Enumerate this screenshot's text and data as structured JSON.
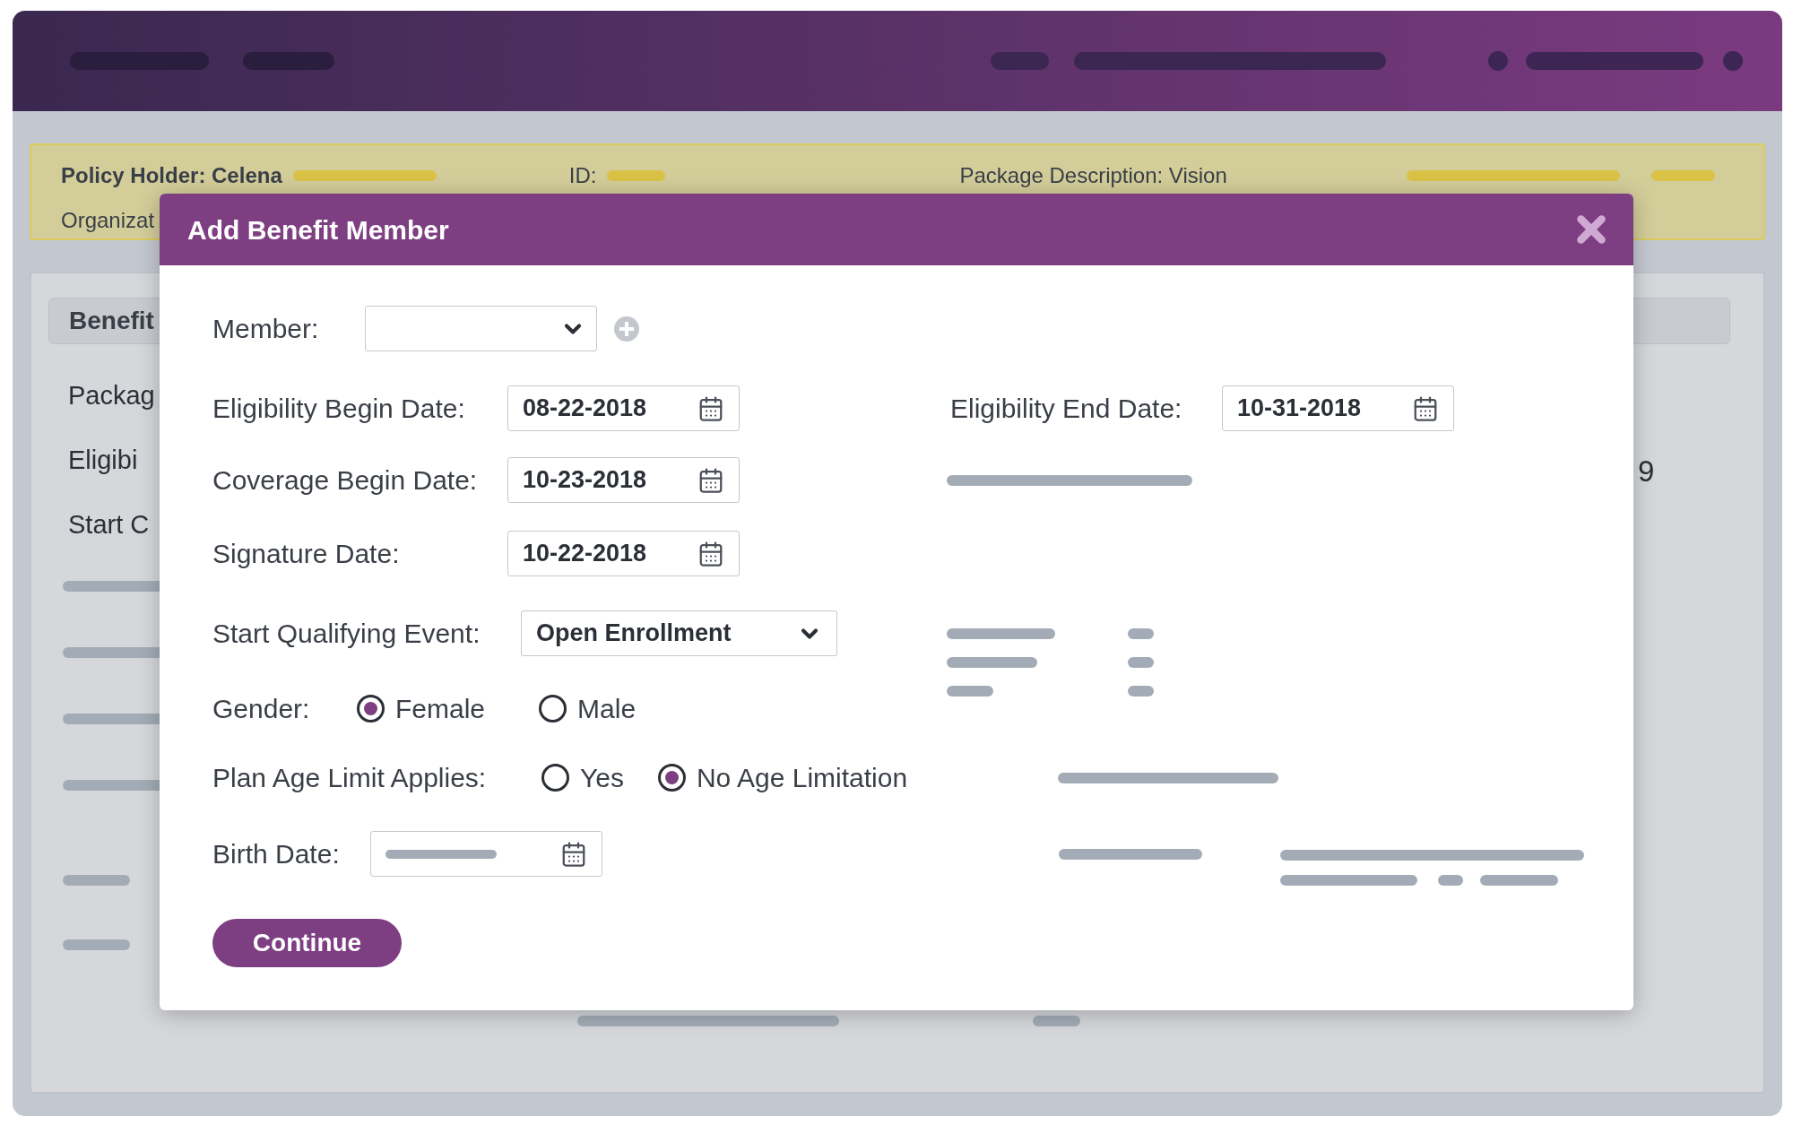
{
  "banner": {
    "policy_holder": "Policy Holder: Celena",
    "id_label": "ID:",
    "package_description": "Package Description: Vision",
    "organization": "Organizat"
  },
  "benefit_tab": "Benefit",
  "left_labels": [
    "Packag",
    "Eligibi",
    "Start C"
  ],
  "right_fragment": "9",
  "dialog": {
    "title": "Add Benefit Member",
    "member": {
      "label": "Member:"
    },
    "eligibility_begin": {
      "label": "Eligibility Begin Date:",
      "value": "08-22-2018"
    },
    "eligibility_end": {
      "label": "Eligibility End Date:",
      "value": "10-31-2018"
    },
    "coverage_begin": {
      "label": "Coverage Begin Date:",
      "value": "10-23-2018"
    },
    "signature": {
      "label": "Signature Date:",
      "value": "10-22-2018"
    },
    "start_qualifying_event": {
      "label": "Start Qualifying Event:",
      "value": "Open Enrollment"
    },
    "gender": {
      "label": "Gender:",
      "options": [
        {
          "label": "Female",
          "selected": true
        },
        {
          "label": "Male",
          "selected": false
        }
      ]
    },
    "plan_age_limit": {
      "label": "Plan Age Limit Applies:",
      "options": [
        {
          "label": "Yes",
          "selected": false
        },
        {
          "label": "No Age Limitation",
          "selected": true
        }
      ]
    },
    "birth_date": {
      "label": "Birth Date:"
    },
    "continue_button": "Continue"
  }
}
